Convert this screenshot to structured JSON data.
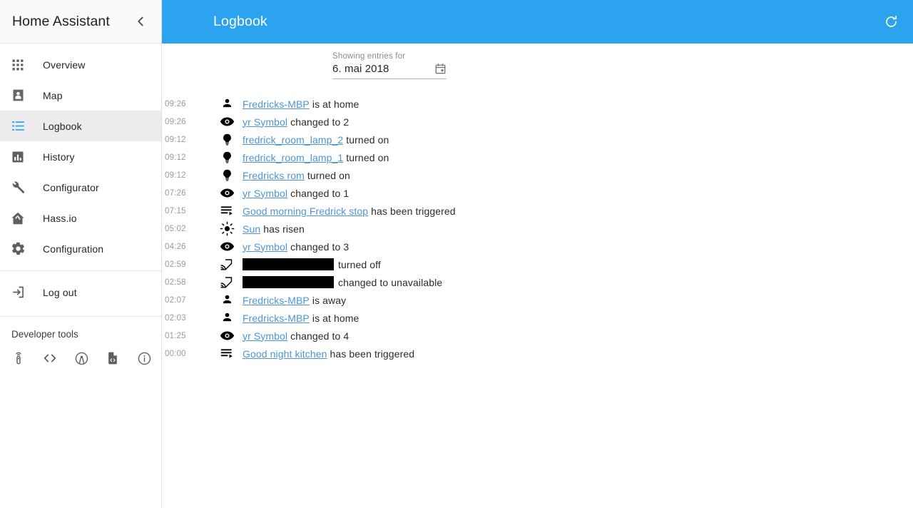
{
  "sidebar": {
    "title": "Home Assistant",
    "collapse_icon": "chevron-left-icon",
    "items": [
      {
        "label": "Overview",
        "icon": "apps-grid-icon",
        "active": false
      },
      {
        "label": "Map",
        "icon": "map-account-icon",
        "active": false
      },
      {
        "label": "Logbook",
        "icon": "format-list-icon",
        "active": true
      },
      {
        "label": "History",
        "icon": "bar-chart-icon",
        "active": false
      },
      {
        "label": "Configurator",
        "icon": "wrench-icon",
        "active": false
      },
      {
        "label": "Hass.io",
        "icon": "home-assistant-icon",
        "active": false
      },
      {
        "label": "Configuration",
        "icon": "gear-icon",
        "active": false
      }
    ],
    "logout": {
      "label": "Log out",
      "icon": "exit-to-app-icon"
    },
    "developer_tools": {
      "title": "Developer tools",
      "icons": [
        "remote-icon",
        "code-tags-icon",
        "broadcast-icon",
        "file-code-icon",
        "information-outline-icon"
      ]
    }
  },
  "toolbar": {
    "title": "Logbook",
    "refresh_icon": "refresh-icon"
  },
  "datepicker": {
    "caption": "Showing entries for",
    "value": "6. mai 2018",
    "icon": "calendar-icon"
  },
  "colors": {
    "accent": "#2ba3ef",
    "link": "#4b95d6",
    "active_bg": "#ececec",
    "sidebar_header_bg": "#fafafa"
  },
  "entries": [
    {
      "time": "09:26",
      "icon": "account-icon",
      "link": "Fredricks-MBP",
      "suffix": "is at home"
    },
    {
      "time": "09:26",
      "icon": "eye-icon",
      "link": "yr Symbol",
      "suffix": "changed to 2"
    },
    {
      "time": "09:12",
      "icon": "lightbulb-icon",
      "link": "fredrick_room_lamp_2",
      "suffix": "turned on"
    },
    {
      "time": "09:12",
      "icon": "lightbulb-icon",
      "link": "fredrick_room_lamp_1",
      "suffix": "turned on"
    },
    {
      "time": "09:12",
      "icon": "lightbulb-icon",
      "link": "Fredricks rom",
      "suffix": "turned on"
    },
    {
      "time": "07:26",
      "icon": "eye-icon",
      "link": "yr Symbol",
      "suffix": "changed to 1"
    },
    {
      "time": "07:15",
      "icon": "playlist-play-icon",
      "link": "Good morning Fredrick stop",
      "suffix": "has been triggered"
    },
    {
      "time": "05:02",
      "icon": "sun-icon",
      "link": "Sun",
      "suffix": "has risen"
    },
    {
      "time": "04:26",
      "icon": "eye-icon",
      "link": "yr Symbol",
      "suffix": "changed to 3"
    },
    {
      "time": "02:59",
      "icon": "cast-icon",
      "link": "",
      "redacted": 128,
      "suffix": "turned off"
    },
    {
      "time": "02:58",
      "icon": "cast-icon",
      "link": "",
      "redacted": 128,
      "suffix": "changed to unavailable"
    },
    {
      "time": "02:07",
      "icon": "account-icon",
      "link": "Fredricks-MBP",
      "suffix": "is away"
    },
    {
      "time": "02:03",
      "icon": "account-icon",
      "link": "Fredricks-MBP",
      "suffix": "is at home"
    },
    {
      "time": "01:25",
      "icon": "eye-icon",
      "link": "yr Symbol",
      "suffix": "changed to 4"
    },
    {
      "time": "00:00",
      "icon": "playlist-play-icon",
      "link": "Good night kitchen",
      "suffix": "has been triggered"
    }
  ]
}
